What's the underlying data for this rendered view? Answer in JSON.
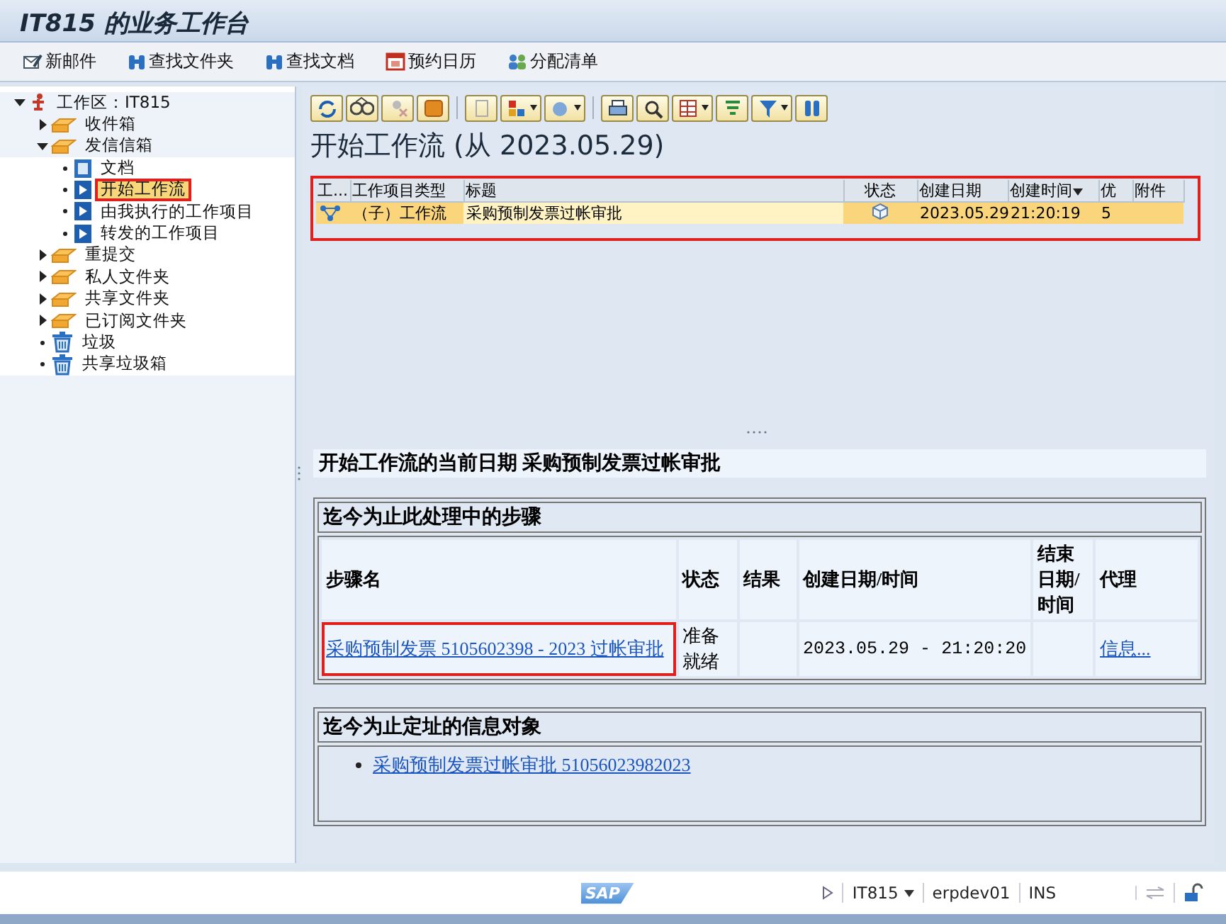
{
  "window": {
    "title": "IT815 的业务工作台"
  },
  "toolbar": [
    {
      "label": "新邮件",
      "kind": "mail"
    },
    {
      "label": "查找文件夹",
      "kind": "find"
    },
    {
      "label": "查找文档",
      "kind": "find"
    },
    {
      "label": "预约日历",
      "kind": "calendar"
    },
    {
      "label": "分配清单",
      "kind": "distribution"
    }
  ],
  "tree": [
    {
      "label": "工作区：IT815",
      "kind": "workplace",
      "expanded": true,
      "selected": false,
      "children": [
        {
          "label": "收件箱",
          "kind": "folder",
          "expanded": false,
          "selected": false
        },
        {
          "label": "发信信箱",
          "kind": "folder",
          "expanded": true,
          "selected": false,
          "children": [
            {
              "label": "文档",
              "kind": "document",
              "selected": false
            },
            {
              "label": "开始工作流",
              "kind": "workflow",
              "selected": true,
              "highlighted": true
            },
            {
              "label": "由我执行的工作项目",
              "kind": "workflow",
              "selected": false
            },
            {
              "label": "转发的工作项目",
              "kind": "workflow",
              "selected": false
            }
          ]
        },
        {
          "label": "重提交",
          "kind": "folder",
          "expanded": false,
          "selected": false
        },
        {
          "label": "私人文件夹",
          "kind": "folder",
          "expanded": false,
          "selected": false
        },
        {
          "label": "共享文件夹",
          "kind": "folder",
          "expanded": false,
          "selected": false
        },
        {
          "label": "已订阅文件夹",
          "kind": "folder",
          "expanded": false,
          "selected": false
        },
        {
          "label": "垃圾",
          "kind": "trash",
          "selected": false
        },
        {
          "label": "共享垃圾箱",
          "kind": "trash",
          "selected": false
        }
      ]
    }
  ],
  "worklist": {
    "title": "开始工作流 (从 2023.05.29)",
    "highlighted": true,
    "columns": [
      {
        "label": "工..."
      },
      {
        "label": "工作项目类型"
      },
      {
        "label": "标题"
      },
      {
        "label": "状态"
      },
      {
        "label": "创建日期"
      },
      {
        "label": "创建时间",
        "sorted": true
      },
      {
        "label": "优"
      },
      {
        "label": "附件"
      }
    ],
    "rows": [
      {
        "type": "（子）工作流",
        "title": "采购预制发票过帐审批",
        "date": "2023.05.29",
        "time": "21:20:19",
        "priority": "5",
        "selected": true
      }
    ]
  },
  "detail": {
    "heading": "开始工作流的当前日期 采购预制发票过帐审批",
    "steps": {
      "title": "迄今为止此处理中的步骤",
      "columns": [
        "步骤名",
        "状态",
        "结果",
        "创建日期/时间",
        "结束日期/时间",
        "代理"
      ],
      "rows": [
        {
          "step": "采购预制发票 5105602398 - 2023 过帐审批",
          "status": "准备就绪",
          "created": "2023.05.29 - 21:20:20",
          "agent": "信息...",
          "highlighted": true
        }
      ]
    },
    "objects": {
      "title": "迄今为止定址的信息对象",
      "items": [
        "采购预制发票过帐审批 51056023982023"
      ]
    }
  },
  "status_bar": {
    "logo": "SAP",
    "system": "IT815",
    "server": "erpdev01",
    "mode": "INS"
  }
}
